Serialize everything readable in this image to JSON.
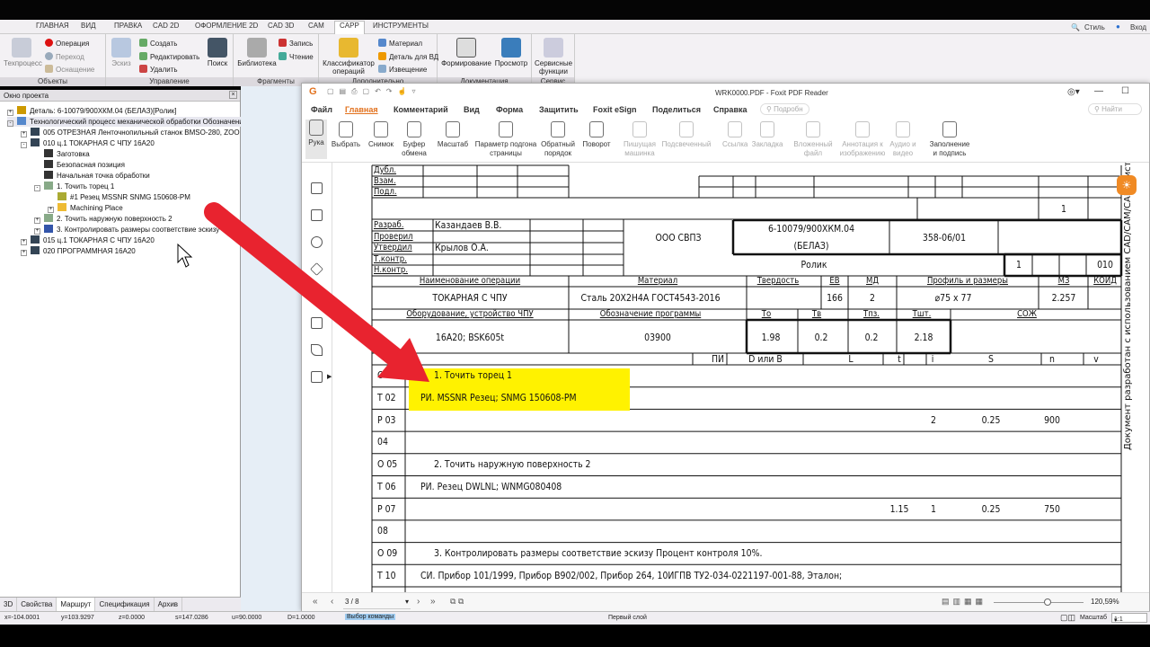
{
  "app": {
    "tabs": [
      "ГЛАВНАЯ",
      "ВИД",
      "ПРАВКА",
      "CAD 2D",
      "ОФОРМЛЕНИЕ 2D",
      "CAD 3D",
      "CAM",
      "CAPP",
      "ИНСТРУМЕНТЫ"
    ],
    "active_tab": "CAPP",
    "right": {
      "style": "Стиль",
      "login": "Вход"
    },
    "ribbon": {
      "groups": [
        "Объекты",
        "Управление",
        "Фрагменты",
        "Дополнительно",
        "Документация",
        "Сервис"
      ],
      "techprocess": "Техпроцесс",
      "operation": "Операция",
      "transition": "Переход",
      "equipment": "Оснащение",
      "sketch": "Эскиз",
      "create": "Создать",
      "edit": "Редактировать",
      "delete": "Удалить",
      "search": "Поиск",
      "library": "Библиотека",
      "record": "Запись",
      "read": "Чтение",
      "classifier": "Классификатор операций",
      "material": "Материал",
      "part_db": "Деталь для ВД",
      "notice": "Извещение",
      "form": "Формирование",
      "preview": "Просмотр",
      "service": "Сервисные функции"
    }
  },
  "project": {
    "title": "Окно проекта",
    "tree": [
      {
        "label": "Деталь: 6-10079/900ХКМ.04 (БЕЛАЗ)[Ролик]"
      },
      {
        "label": "Технологический процесс механической обработки  Обозначение"
      },
      {
        "label": "005  ОТРЕЗНАЯ Ленточнопильный станок BMSO-280, ZOO"
      },
      {
        "label": "010 ц.1 ТОКАРНАЯ С ЧПУ 16А20"
      },
      {
        "label": "Заготовка"
      },
      {
        "label": "Безопасная позиция"
      },
      {
        "label": "Начальная точка обработки"
      },
      {
        "label": "1.  Точить торец 1"
      },
      {
        "label": "#1 Резец MSSNR    SNMG 150608-PM"
      },
      {
        "label": "Machining Place"
      },
      {
        "label": "2.  Точить наружную поверхность 2"
      },
      {
        "label": "3.  Контролировать размеры соответствие эскизу"
      },
      {
        "label": "015 ц.1 ТОКАРНАЯ С ЧПУ 16А20"
      },
      {
        "label": "020  ПРОГРАММНАЯ 16А20"
      }
    ],
    "tabs": [
      "3D",
      "Свойства",
      "Маршрут",
      "Спецификация",
      "Архив"
    ]
  },
  "foxit": {
    "title": "WRK0000.PDF - Foxit PDF Reader",
    "menu": [
      "Файл",
      "Главная",
      "Комментарий",
      "Вид",
      "Форма",
      "Защитить",
      "Foxit eSign",
      "Поделиться",
      "Справка"
    ],
    "more": "Подробн",
    "find": "Найти",
    "tools": [
      {
        "label": "Рука"
      },
      {
        "label": "Выбрать"
      },
      {
        "label": "Снимок"
      },
      {
        "label": "Буфер обмена"
      },
      {
        "label": "Масштаб"
      },
      {
        "label": "Параметр подгона страницы"
      },
      {
        "label": "Обратный порядок"
      },
      {
        "label": "Поворот"
      },
      {
        "label": "Пишущая машинка"
      },
      {
        "label": "Подсвеченный"
      },
      {
        "label": "Ссылка"
      },
      {
        "label": "Закладка"
      },
      {
        "label": "Вложенный файл"
      },
      {
        "label": "Аннотация к изображению"
      },
      {
        "label": "Аудио и видео"
      },
      {
        "label": "Заполнение и подпись"
      }
    ],
    "page_indicator": "3 / 8",
    "zoom": "120,59%"
  },
  "doc": {
    "top_labels": [
      "Дубл.",
      "Взам.",
      "Подл."
    ],
    "sheet_count": "1",
    "roles": [
      "Разраб.",
      "Проверил",
      "Утвердил",
      "Т.контр.",
      "Н.контр."
    ],
    "developer": "Казандаев В.В.",
    "approver": "Крылов О.А.",
    "company": "ООО СВПЗ",
    "designation": "6-10079/900ХКМ.04",
    "designation2": "(БЕЛАЗ)",
    "doc_number": "358-06/01",
    "part_name": "Ролик",
    "sheet": "1",
    "op_number": "010",
    "h1": {
      "op_name": "Наименование операции",
      "material": "Материал",
      "hardness": "Твердость",
      "ev": "ЕВ",
      "md": "МД",
      "profile": "Профиль и размеры",
      "mz": "МЗ",
      "koid": "КОИД"
    },
    "v1": {
      "op_name": "ТОКАРНАЯ С ЧПУ",
      "material": "Сталь 20Х2Н4А ГОСТ4543-2016",
      "ev": "166",
      "md": "2",
      "profile": "⌀75 x 77",
      "mz": "2.257"
    },
    "h2": {
      "equipment": "Оборудование, устройство ЧПУ",
      "program": "Обозначение программы",
      "to": "То",
      "tv": "Тв",
      "tpz": "Тпз.",
      "tsht": "Тшт.",
      "coolant": "СОЖ"
    },
    "v2": {
      "equipment": "16А20; BSK605t",
      "program": "03900",
      "to": "1.98",
      "tv": "0.2",
      "tpz": "0.2",
      "tsht": "2.18"
    },
    "h3": {
      "pi": "ПИ",
      "d": "D или B",
      "l": "L",
      "t": "t",
      "i": "i",
      "s": "S",
      "n": "n",
      "v": "v"
    },
    "rows": [
      {
        "code": "О 01",
        "text": "1. Точить торец 1",
        "indent": true,
        "highlight": true
      },
      {
        "code": "Т 02",
        "text": "РИ. MSSNR Резец; SNMG 150608-PM",
        "highlight": true
      },
      {
        "code": "Р 03",
        "i": "2",
        "s": "0.25",
        "n": "900"
      },
      {
        "code": "04"
      },
      {
        "code": "О 05",
        "text": "2. Точить наружную поверхность 2",
        "indent": true
      },
      {
        "code": "Т 06",
        "text": "РИ. Резец DWLNL; WNMG080408"
      },
      {
        "code": "Р 07",
        "t": "1.15",
        "i": "1",
        "s": "0.25",
        "n": "750"
      },
      {
        "code": "08"
      },
      {
        "code": "О 09",
        "text": "3. Контролировать размеры соответствие эскизу Процент контроля 10%.",
        "indent": true
      },
      {
        "code": "Т 10",
        "text": "СИ. Прибор 101/1999, Прибор В902/002, Прибор 264, 10ИГПВ ТУ2-034-0221197-001-88, Эталон;"
      }
    ],
    "side_text": "Документ разработан с использованием CAD/CAM/CAPP сист"
  },
  "status": {
    "x": "x=-104.0001",
    "y": "y=103.9297",
    "z": "z=0.0000",
    "s": "s=147.0286",
    "u": "u=90.0000",
    "d": "D=1.0000",
    "command": "Выбор команды",
    "layer": "Первый слой",
    "scale_label": "Масштаб",
    "scale": "1:1"
  },
  "colors": {
    "highlight": "#fff200",
    "arrow": "#e8232f",
    "foxit_accent": "#e2711d"
  }
}
